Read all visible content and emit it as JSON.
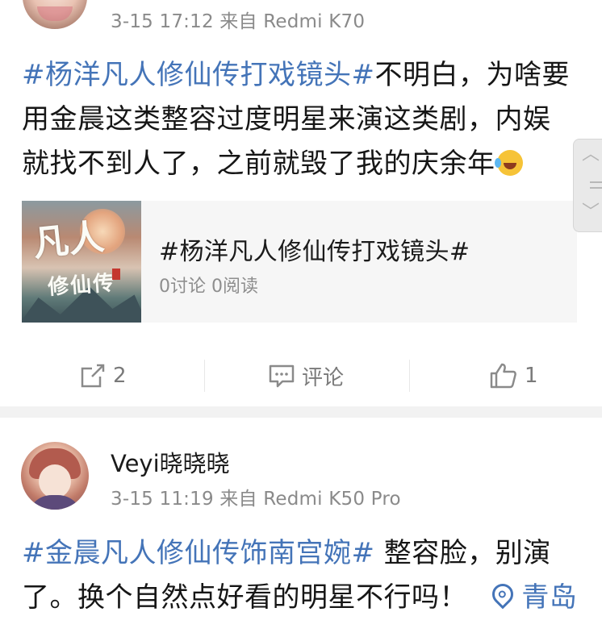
{
  "post1": {
    "meta": "3-15 17:12 来自 Redmi K70",
    "topic": "#杨洋凡人修仙传打戏镜头#",
    "text_line1": "不明白，为啥要",
    "text_line2": "用金晨这类整容过度明星来演这类剧，内娱",
    "text_line3": "就找不到人了，之前就毁了我的庆余年",
    "emoji": "laughing-crying-emoji",
    "card": {
      "thumb_text_1": "凡人",
      "thumb_text_2": "修仙传",
      "title": "#杨洋凡人修仙传打戏镜头#",
      "stats": "0讨论 0阅读"
    },
    "actions": {
      "repost_count": "2",
      "comment_label": "评论",
      "like_count": "1"
    }
  },
  "post2": {
    "username": "Veyi晓晓晓",
    "meta": "3-15 11:19 来自 Redmi K50 Pro",
    "topic": "#金晨凡人修仙传饰南宫婉#",
    "text_line1": " 整容脸，别演",
    "text_line2": "了。换个自然点好看的明星不行吗！",
    "location": "青岛"
  },
  "colors": {
    "topic_blue": "#4474b8",
    "meta_gray": "#8a8a8a",
    "separator": "#f2f2f2"
  }
}
